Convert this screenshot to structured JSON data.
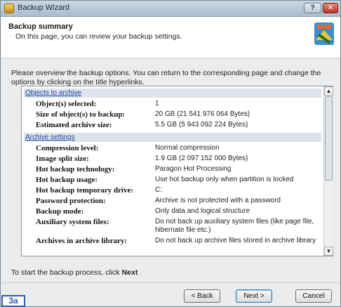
{
  "window": {
    "title": "Backup Wizard",
    "help_glyph": "?",
    "close_glyph": "✕"
  },
  "header": {
    "title": "Backup summary",
    "subtitle": "On this page, you can review your backup settings."
  },
  "intro": "Please overview the backup options. You can return to the corresponding page and change the options by clicking on the title hyperlinks.",
  "sections": [
    {
      "link": "Objects to archive",
      "rows": [
        {
          "label": "Object(s) selected:",
          "value": "1"
        },
        {
          "label": "Size of object(s) to backup:",
          "value": "20 GB (21 541 976 064 Bytes)"
        },
        {
          "label": "Estimated archive size:",
          "value": "5.5 GB (5 943 092 224 Bytes)"
        }
      ]
    },
    {
      "link": "Archive settings",
      "rows": [
        {
          "label": "Compression level:",
          "value": "Normal compression"
        },
        {
          "label": "Image split size:",
          "value": "1.9 GB (2 097 152 000 Bytes)"
        },
        {
          "label": "Hot backup technology:",
          "value": "Paragon Hot Processing"
        },
        {
          "label": "Hot backup usage:",
          "value": "Use hot backup only when partition is locked"
        },
        {
          "label": "Hot backup temporary drive:",
          "value": "C:"
        },
        {
          "label": "Password protection:",
          "value": "Archive is not protected with a password"
        },
        {
          "label": "Backup mode:",
          "value": "Only data and logical structure"
        },
        {
          "label": "Auxiliary system files:",
          "value": "Do not back up auxiliary system files (like page file, hibernate file etc.)"
        },
        {
          "label": "Archives in archive library:",
          "value": "Do not back up archive files stored in archive library"
        }
      ]
    }
  ],
  "footer": {
    "prefix": "To start the backup process, click ",
    "bold": "Next"
  },
  "buttons": {
    "back": "< Back",
    "next": "Next >",
    "cancel": "Cancel"
  },
  "scrollbar": {
    "up": "▲",
    "down": "▼"
  },
  "badge": "3a"
}
